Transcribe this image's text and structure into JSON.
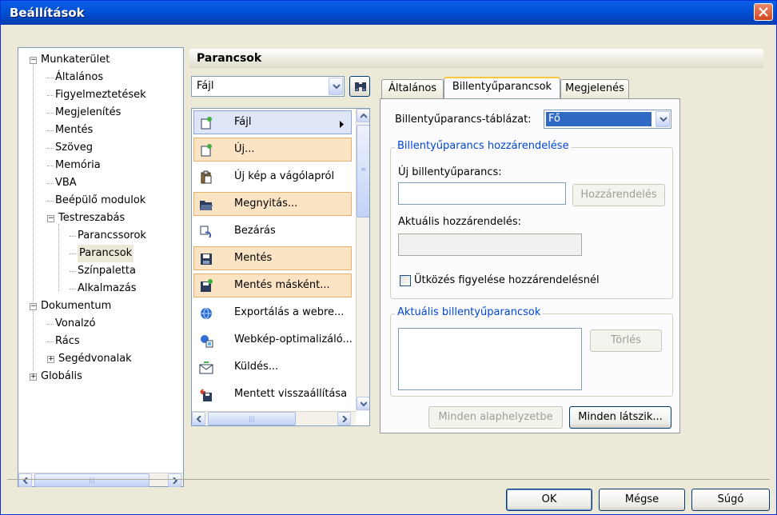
{
  "window": {
    "title": "Beállítások"
  },
  "tree": [
    {
      "label": "Munkaterület",
      "toggle": "−"
    },
    {
      "label": "Általános"
    },
    {
      "label": "Figyelmeztetések"
    },
    {
      "label": "Megjelenítés"
    },
    {
      "label": "Mentés"
    },
    {
      "label": "Szöveg"
    },
    {
      "label": "Memória"
    },
    {
      "label": "VBA"
    },
    {
      "label": "Beépülő modulok"
    },
    {
      "label": "Testreszabás",
      "toggle": "−"
    },
    {
      "label": "Parancssorok"
    },
    {
      "label": "Parancsok"
    },
    {
      "label": "Színpaletta"
    },
    {
      "label": "Alkalmazás"
    },
    {
      "label": "Dokumentum",
      "toggle": "−"
    },
    {
      "label": "Vonalzó"
    },
    {
      "label": "Rács"
    },
    {
      "label": "Segédvonalak",
      "toggle": "+"
    },
    {
      "label": "Globális",
      "toggle": "+"
    }
  ],
  "section_title": "Parancsok",
  "category_combo": {
    "value": "Fájl"
  },
  "commands": [
    {
      "label": "Fájl",
      "icon": "file-new-icon"
    },
    {
      "label": "Új...",
      "icon": "file-new-icon"
    },
    {
      "label": "Új kép a vágólapról",
      "icon": "clipboard-icon"
    },
    {
      "label": "Megnyitás...",
      "icon": "folder-open-icon"
    },
    {
      "label": "Bezárás",
      "icon": "close-doc-icon"
    },
    {
      "label": "Mentés",
      "icon": "floppy-icon"
    },
    {
      "label": "Mentés másként...",
      "icon": "floppy-saveas-icon"
    },
    {
      "label": "Exportálás a webre...",
      "icon": "globe-icon"
    },
    {
      "label": "Webkép-optimalizáló...",
      "icon": "web-optimizer-icon"
    },
    {
      "label": "Küldés...",
      "icon": "envelope-icon"
    },
    {
      "label": "Mentett visszaállítása",
      "icon": "revert-icon"
    }
  ],
  "tabs": [
    {
      "label": "Általános"
    },
    {
      "label": "Billentyűparancsok"
    },
    {
      "label": "Megjelenés"
    }
  ],
  "shortcuts": {
    "table_label": "Billentyűparancs-táblázat:",
    "table_value": "Fő",
    "assign_group": "Billentyűparancs hozzárendelése",
    "new_shortcut_label": "Új billentyűparancs:",
    "new_shortcut_value": "",
    "assign_button": "Hozzárendelés",
    "current_assignment_label": "Aktuális hozzárendelés:",
    "current_assignment_value": "",
    "conflict_checkbox": "Ütközés figyelése hozzárendelésnél",
    "current_group": "Aktuális billentyűparancsok",
    "delete_button": "Törlés",
    "reset_all_button": "Minden alaphelyzetbe",
    "view_all_button": "Minden látszik..."
  },
  "dialog_buttons": {
    "ok": "OK",
    "cancel": "Mégse",
    "help": "Súgó"
  },
  "colors": {
    "title_bar": "#0153d8",
    "highlight": "#fbe4c4",
    "group_title": "#0046d5"
  }
}
